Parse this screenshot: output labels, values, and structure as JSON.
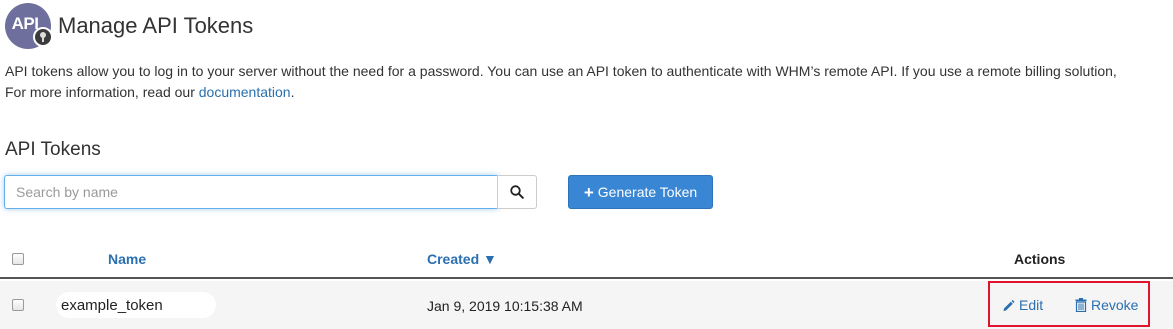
{
  "header": {
    "logo_text": "API",
    "title": "Manage API Tokens"
  },
  "intro": {
    "line1": "API tokens allow you to log in to your server without the need for a password. You can use an API token to authenticate with WHM’s remote API. If you use a remote billing solution,",
    "line2_prefix": "For more information, read our ",
    "doc_link": "documentation",
    "line2_suffix": "."
  },
  "section": {
    "title": "API Tokens"
  },
  "search": {
    "placeholder": "Search by name",
    "value": ""
  },
  "generate_button": {
    "label": "Generate Token"
  },
  "table": {
    "columns": {
      "name": "Name",
      "created": "Created ▼",
      "actions": "Actions"
    },
    "rows": [
      {
        "name": "example_token",
        "created": "Jan 9, 2019 10:15:38 AM",
        "edit_label": "Edit",
        "revoke_label": "Revoke"
      }
    ]
  },
  "colors": {
    "accent": "#3886d4",
    "link": "#2a6fb0",
    "highlight_border": "#e0142c"
  }
}
